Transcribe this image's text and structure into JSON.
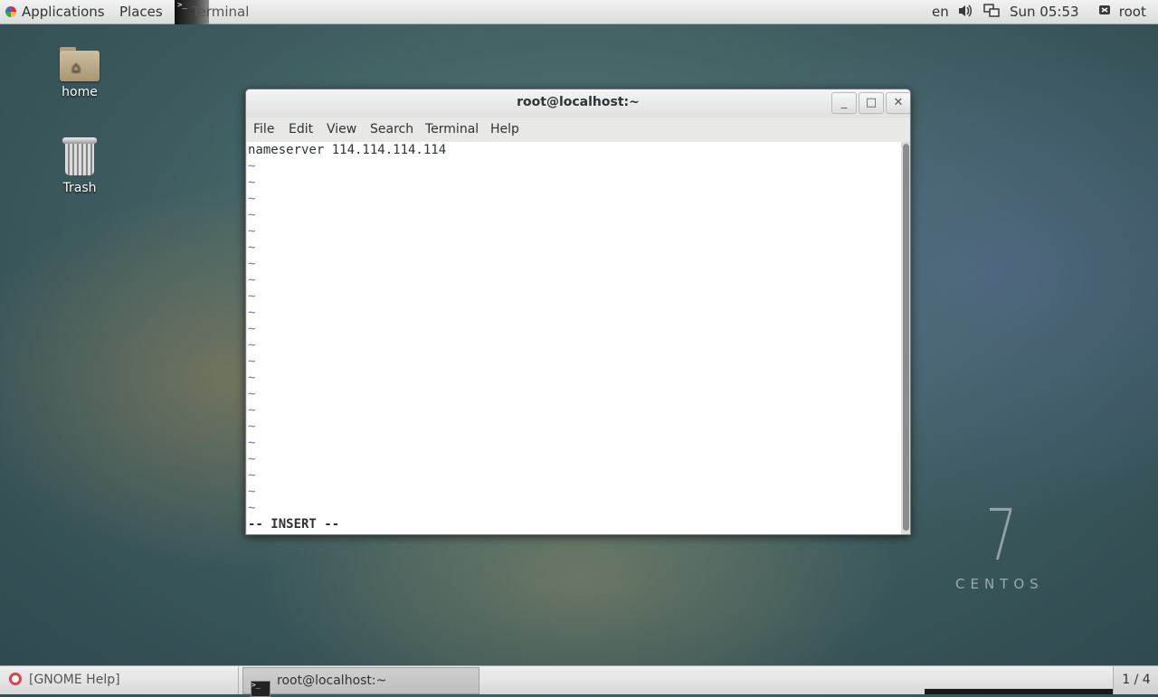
{
  "top_panel": {
    "applications_label": "Applications",
    "places_label": "Places",
    "active_app_label": "Terminal",
    "language": "en",
    "clock": "Sun 05:53",
    "user": "root"
  },
  "desktop": {
    "icons": [
      {
        "label": "home",
        "icon": "home-folder-icon"
      },
      {
        "label": "Trash",
        "icon": "trash-icon"
      }
    ],
    "watermark": {
      "number": "7",
      "word": "CENTOS"
    }
  },
  "window": {
    "title": "root@localhost:~",
    "menu": [
      "File",
      "Edit",
      "View",
      "Search",
      "Terminal",
      "Help"
    ],
    "content": {
      "first_line": "nameserver 114.114.114.114",
      "tilde": "~",
      "mode_line": "-- INSERT --"
    }
  },
  "taskbar": {
    "items": [
      {
        "label": "[GNOME Help]",
        "icon": "help-icon"
      },
      {
        "label": "root@localhost:~",
        "icon": "terminal-icon"
      }
    ],
    "workspace": "1 / 4"
  }
}
